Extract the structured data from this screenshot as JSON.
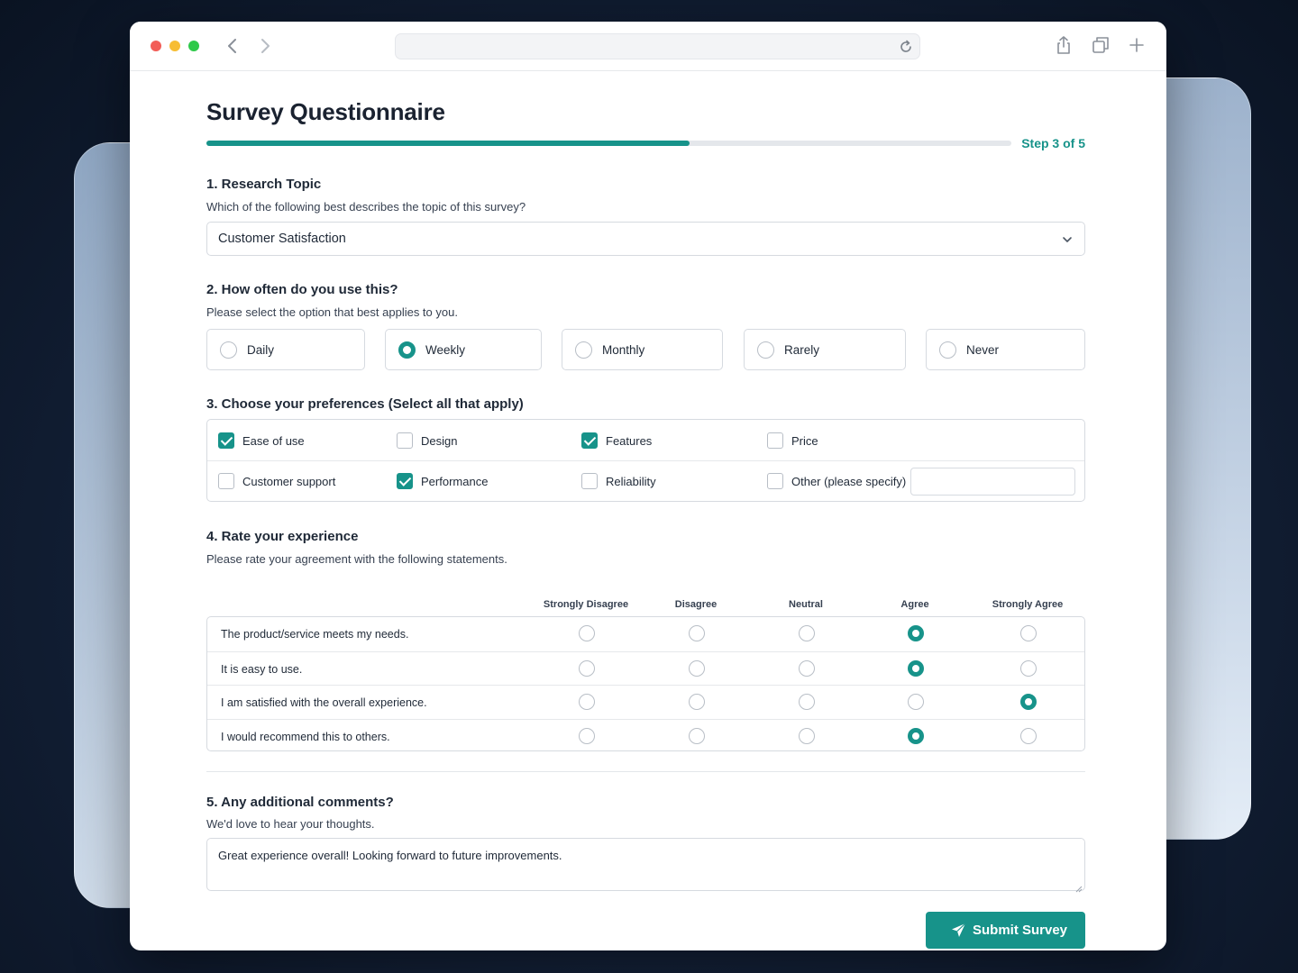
{
  "browser": {
    "url": "",
    "icons": [
      "back-icon",
      "forward-icon",
      "reload-icon",
      "share-icon",
      "tabs-icon",
      "plus-icon"
    ]
  },
  "page": {
    "title": "Survey Questionnaire",
    "step_label": "Step 3 of 5",
    "progress_fraction": 0.6,
    "accent_color": "#17938a"
  },
  "q1": {
    "title": "1. Research Topic",
    "subtitle": "Which of the following best describes the topic of this survey?",
    "selected": "Customer Satisfaction"
  },
  "q2": {
    "title": "2. How often do you use this?",
    "subtitle": "Please select the option that best applies to you.",
    "options": [
      {
        "label": "Daily",
        "selected": false
      },
      {
        "label": "Weekly",
        "selected": true
      },
      {
        "label": "Monthly",
        "selected": false
      },
      {
        "label": "Rarely",
        "selected": false
      },
      {
        "label": "Never",
        "selected": false
      }
    ]
  },
  "q3": {
    "title": "3. Choose your preferences (Select all that apply)",
    "options": [
      {
        "label": "Ease of use",
        "checked": true
      },
      {
        "label": "Design",
        "checked": false
      },
      {
        "label": "Features",
        "checked": true
      },
      {
        "label": "Price",
        "checked": false
      },
      {
        "label": "Customer support",
        "checked": false
      },
      {
        "label": "Performance",
        "checked": true
      },
      {
        "label": "Reliability",
        "checked": false
      },
      {
        "label": "Other (please specify)",
        "checked": false
      }
    ],
    "other_value": ""
  },
  "q4": {
    "title": "4. Rate your experience",
    "subtitle": "Please rate your agreement with the following statements.",
    "columns": [
      "Strongly Disagree",
      "Disagree",
      "Neutral",
      "Agree",
      "Strongly Agree"
    ],
    "rows": [
      {
        "statement": "The product/service meets my needs.",
        "selected": 3
      },
      {
        "statement": "It is easy to use.",
        "selected": 3
      },
      {
        "statement": "I am satisfied with the overall experience.",
        "selected": 4
      },
      {
        "statement": "I would recommend this to others.",
        "selected": 3
      }
    ]
  },
  "q5": {
    "title": "5. Any additional comments?",
    "subtitle": "We'd love to hear your thoughts.",
    "value": "Great experience overall! Looking forward to future improvements."
  },
  "submit": {
    "label": "Submit Survey"
  }
}
